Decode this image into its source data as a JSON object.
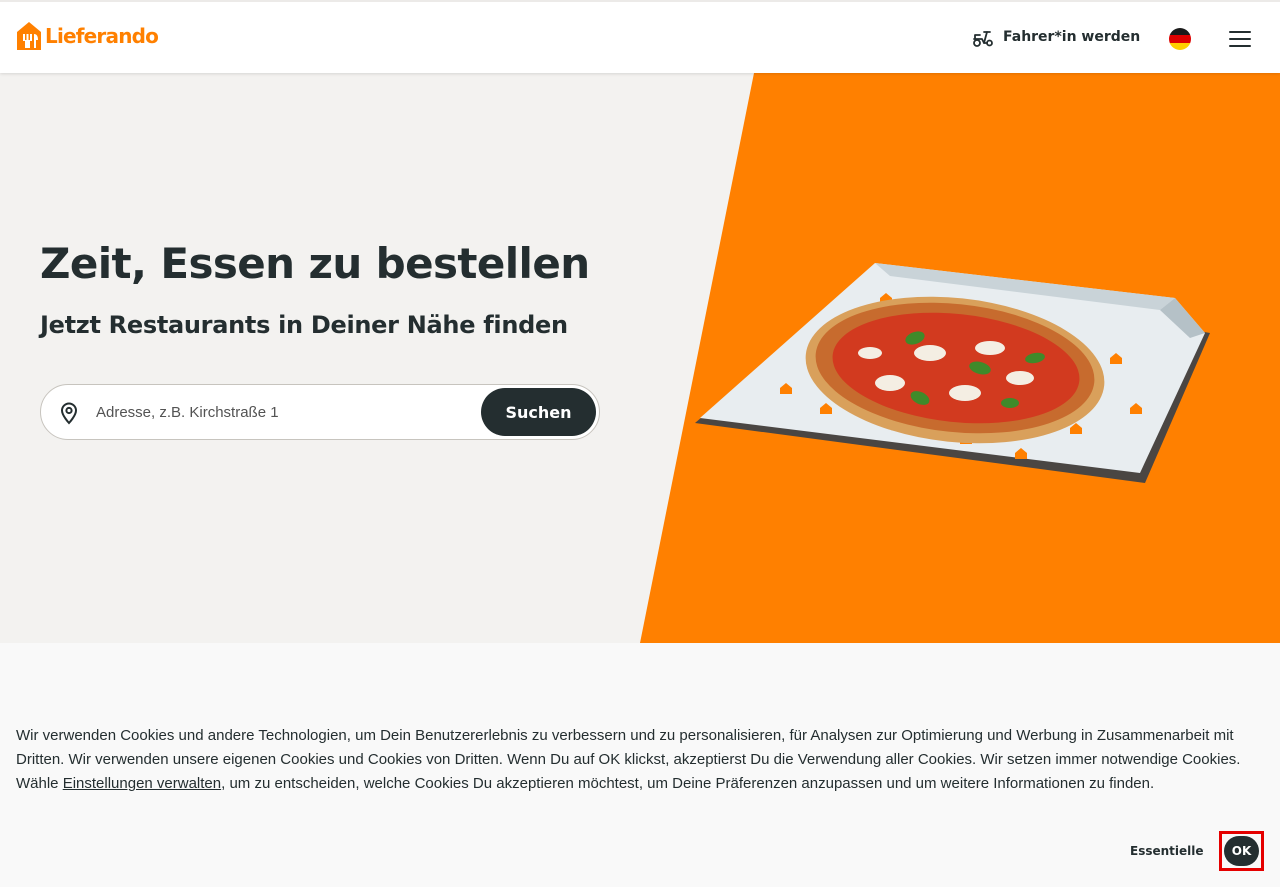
{
  "header": {
    "brand": "Lieferando",
    "driver_link_label": "Fahrer*in werden",
    "language_flag": "de-flag-icon",
    "menu_icon": "hamburger-menu-icon"
  },
  "hero": {
    "title": "Zeit, Essen zu bestellen",
    "subtitle": "Jetzt Restaurants in Deiner Nähe finden",
    "search": {
      "placeholder": "Adresse, z.B. Kirchstraße 1",
      "value": "",
      "button_label": "Suchen",
      "icon": "location-pin-icon"
    },
    "image": "pizza-in-box-image"
  },
  "cookie_banner": {
    "text_before_link": "Wir verwenden Cookies und andere Technologien, um Dein Benutzererlebnis zu verbessern und zu personalisieren, für Analysen zur Optimierung und Werbung in Zusammenarbeit mit Dritten. Wir verwenden unsere eigenen Cookies und Cookies von Dritten. Wenn Du auf OK klickst, akzeptierst Du die Verwendung aller Cookies. Wir setzen immer notwendige Cookies. Wähle ",
    "link_label": "Einstellungen verwalten",
    "text_after_link": ", um zu entscheiden, welche Cookies Du akzeptieren möchtest, um Deine Präferenzen anzupassen und um weitere Informationen zu finden.",
    "essential_label": "Essentielle",
    "ok_label": "OK"
  },
  "colors": {
    "brand_orange": "#ff8000",
    "dark": "#242e30",
    "hero_bg": "#f3f2f0",
    "highlight": "#e50000"
  }
}
